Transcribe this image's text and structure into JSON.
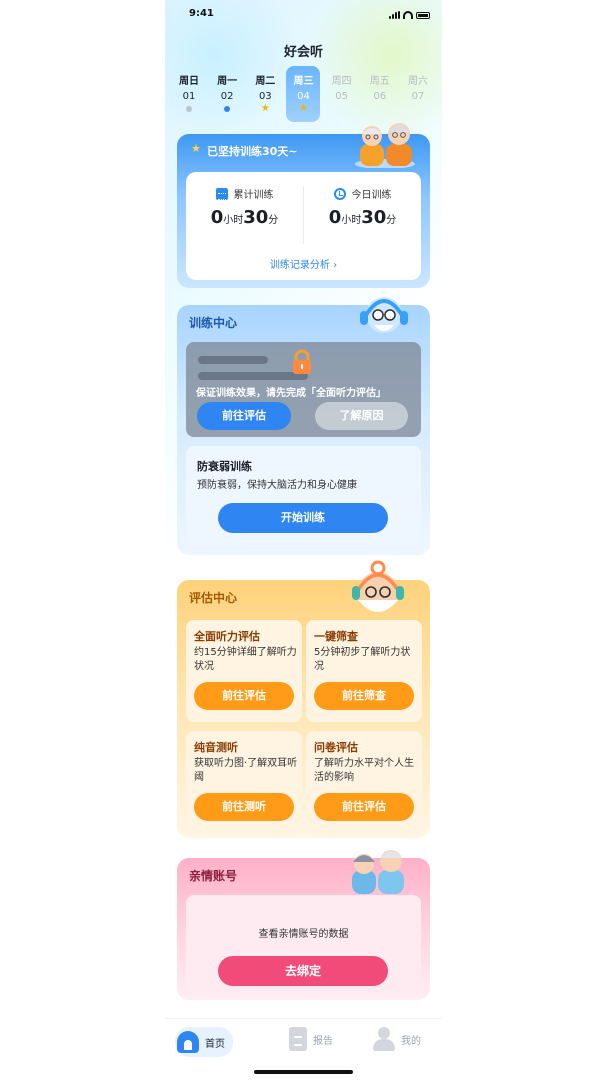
{
  "status_bar": {
    "time": "9:41"
  },
  "app": {
    "title": "好会听"
  },
  "week": [
    {
      "weekday": "周日",
      "date": "01",
      "mark": "dot-gray",
      "active": false,
      "future": false
    },
    {
      "weekday": "周一",
      "date": "02",
      "mark": "dot-blue",
      "active": false,
      "future": false
    },
    {
      "weekday": "周二",
      "date": "03",
      "mark": "star",
      "active": false,
      "future": false
    },
    {
      "weekday": "周三",
      "date": "04",
      "mark": "star",
      "active": true,
      "future": false
    },
    {
      "weekday": "周四",
      "date": "05",
      "mark": "none",
      "active": false,
      "future": true
    },
    {
      "weekday": "周五",
      "date": "06",
      "mark": "none",
      "active": false,
      "future": true
    },
    {
      "weekday": "周六",
      "date": "07",
      "mark": "none",
      "active": false,
      "future": true
    }
  ],
  "streak": {
    "text": "已坚持训练30天~",
    "total_label": "累计训练",
    "total": {
      "hours": "0",
      "hour_unit": "小时",
      "minutes": "30",
      "minute_unit": "分"
    },
    "today_label": "今日训练",
    "today": {
      "hours": "0",
      "hour_unit": "小时",
      "minutes": "30",
      "minute_unit": "分"
    },
    "record_link": "训练记录分析 ›"
  },
  "training_center": {
    "title": "训练中心",
    "lock_message": "保证训练效果，请先完成「全面听力评估」",
    "go_assess": "前往评估",
    "learn_why": "了解原因",
    "anti_aging_title": "防衰弱训练",
    "anti_aging_desc": "预防衰弱，保持大脑活力和身心健康",
    "start_button": "开始训练"
  },
  "eval_center": {
    "title": "评估中心",
    "items": [
      {
        "title": "全面听力评估",
        "desc": "约15分钟详细了解听力状况",
        "button": "前往评估"
      },
      {
        "title": "一键筛查",
        "desc": "5分钟初步了解听力状况",
        "button": "前往筛查"
      },
      {
        "title": "纯音测听",
        "desc": "获取听力图·了解双耳听阈",
        "button": "前往测听"
      },
      {
        "title": "问卷评估",
        "desc": "了解听力水平对个人生活的影响",
        "button": "前往评估"
      }
    ]
  },
  "family": {
    "title": "亲情账号",
    "desc": "查看亲情账号的数据",
    "button": "去绑定"
  },
  "tabbar": {
    "home": "首页",
    "report": "报告",
    "mine": "我的"
  },
  "colors": {
    "primary": "#2f86f2",
    "orange": "#ff9b17",
    "pink": "#f14b79",
    "star": "#f6b400"
  }
}
